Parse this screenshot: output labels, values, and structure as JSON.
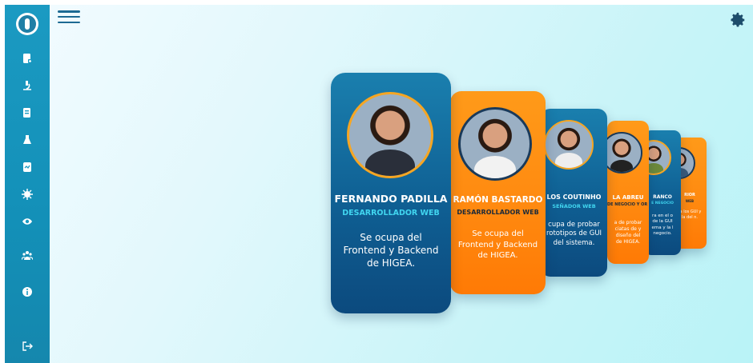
{
  "sidebar": {
    "logo_icon": "higea-logo-icon",
    "items": [
      {
        "icon": "patient-record-icon"
      },
      {
        "icon": "microscope-icon"
      },
      {
        "icon": "lab-document-icon"
      },
      {
        "icon": "flask-icon"
      },
      {
        "icon": "report-icon"
      },
      {
        "icon": "virus-icon"
      },
      {
        "icon": "eye-icon"
      },
      {
        "icon": "team-icon"
      },
      {
        "icon": "info-icon"
      }
    ],
    "logout_icon": "logout-icon"
  },
  "header": {
    "menu_icon": "hamburger-menu-icon",
    "settings_icon": "gear-icon"
  },
  "cards": [
    {
      "name": "FERNANDO PADILLA",
      "role": "DESARROLLADOR WEB",
      "desc": "Se ocupa del Frontend y Backend de HIGEA.",
      "theme": "blue"
    },
    {
      "name": "RAMÓN BASTARDO",
      "role": "DESARROLLADOR WEB",
      "desc": "Se ocupa del Frontend y Backend de HIGEA.",
      "theme": "orange"
    },
    {
      "name": "LOS COUTINHO",
      "role": "SEÑADOR WEB",
      "desc": "cupa de probar rototipos de GUI del sistema.",
      "theme": "blue"
    },
    {
      "name": "LA ABREU",
      "role": "DE NEGOCIO Y OR WEB",
      "desc": "a de probar ciatas de y diseño del de HIGEA.",
      "theme": "orange"
    },
    {
      "name": "RANCO",
      "role": "E NEGOCIO",
      "desc": "ra en el o de la GUI ema y la l negocio.",
      "theme": "blue"
    },
    {
      "name": "RIOR",
      "role": "WEB",
      "desc": "ta los GUI y la del n.",
      "theme": "orange"
    }
  ]
}
